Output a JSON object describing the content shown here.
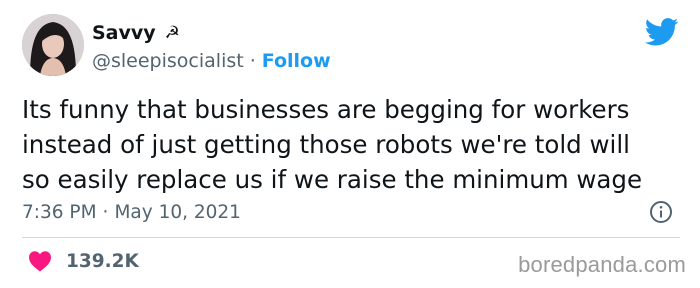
{
  "author": {
    "display_name": "Savvy",
    "name_emoji": "☭",
    "handle": "@sleepisocialist",
    "separator": "·",
    "follow_label": "Follow"
  },
  "tweet": {
    "lines": [
      "Its funny that businesses are begging for workers",
      "instead of just getting those robots we're told will",
      "so easily replace us if we raise the minimum wage"
    ],
    "time": "7:36 PM",
    "separator": "·",
    "date": "May 10, 2021"
  },
  "engagement": {
    "likes": "139.2K"
  },
  "watermark": "boredpanda.com",
  "colors": {
    "brand_blue": "#1d9bf0",
    "heart_red": "#f91880",
    "secondary_text": "#536471"
  },
  "icons": {
    "brand": "twitter-bird-icon",
    "info": "info-icon",
    "like": "heart-icon"
  }
}
